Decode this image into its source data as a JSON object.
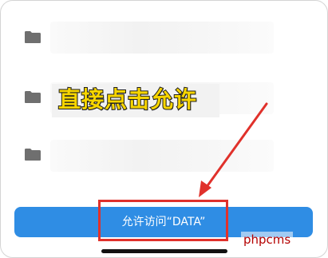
{
  "folders": [
    {
      "icon": "folder-icon"
    },
    {
      "icon": "folder-icon"
    },
    {
      "icon": "folder-icon"
    }
  ],
  "annotation": {
    "text": "直接点击允许",
    "text_color": "#f7d500"
  },
  "allow_button": {
    "label": "允许访问“DATA”",
    "color": "#2f8de4"
  },
  "highlight": {
    "color": "#e0312b"
  },
  "watermark": {
    "text": "phpcms"
  }
}
